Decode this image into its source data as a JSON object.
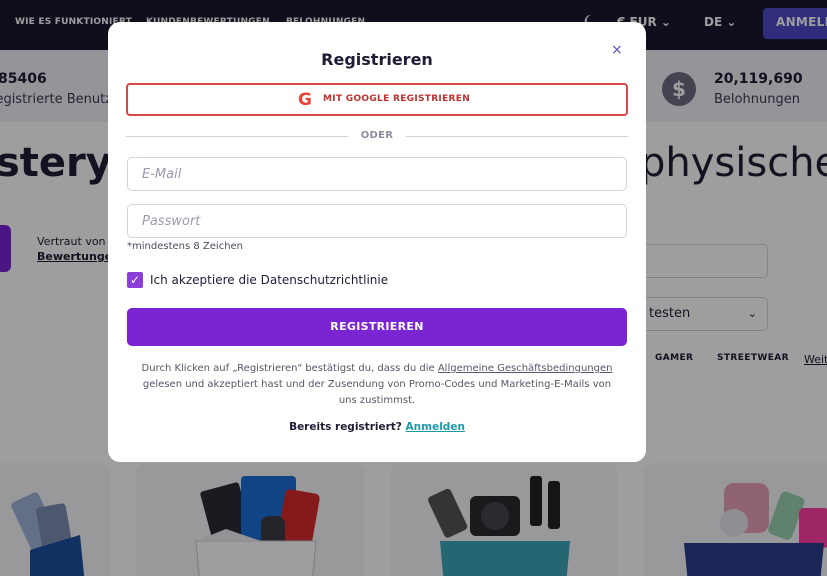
{
  "topnav": {
    "items": [
      "WIE ES FUNKTIONIERT",
      "KUNDENBEWERTUNGEN",
      "BELOHNUNGEN"
    ],
    "currency": "€ EUR",
    "language": "DE",
    "login": "ANMELDEN"
  },
  "stats": {
    "left_number": "85406",
    "left_label": "Registrierte Benutzer",
    "right_number": "20,119,690",
    "right_label": "Belohnungen",
    "right_icon": "$"
  },
  "hero": {
    "left_fragment": "stery-",
    "right_fragment": "physische"
  },
  "trust": {
    "line1": "Vertraut von",
    "line2": "Bewertungen"
  },
  "filter": {
    "sort_value": "testen"
  },
  "categories": [
    "GAMER",
    "STREETWEAR"
  ],
  "categories_more": "Weit",
  "modal": {
    "title": "Registrieren",
    "close": "×",
    "google_label": "MIT GOOGLE REGISTRIEREN",
    "google_letter": "G",
    "divider": "ODER",
    "email_placeholder": "E-Mail",
    "password_placeholder": "Passwort",
    "password_hint": "*mindestens 8 Zeichen",
    "privacy_label": "Ich akzeptiere die Datenschutzrichtlinie",
    "privacy_checked": true,
    "submit": "REGISTRIEREN",
    "legal_prefix": "Durch Klicken auf „Registrieren\" bestätigst du, dass du die",
    "legal_link": "Allgemeine Geschäftsbedingungen",
    "legal_suffix": "gelesen und akzeptiert hast und der Zusendung von Promo-Codes und Marketing-E-Mails von uns zustimmst.",
    "already_text": "Bereits registriert?",
    "login_link": "Anmelden"
  },
  "colors": {
    "primary_purple": "#7b24d1",
    "google_red": "#d94848",
    "link_teal": "#1a9aa8",
    "nav_dark": "#171730"
  }
}
